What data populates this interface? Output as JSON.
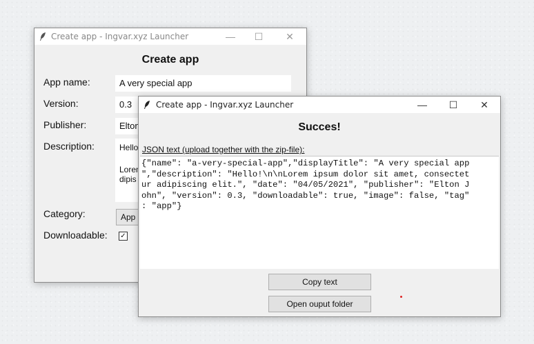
{
  "back_window": {
    "title": "Create app - Ingvar.xyz Launcher",
    "heading": "Create app",
    "labels": {
      "app_name": "App name:",
      "version": "Version:",
      "publisher": "Publisher:",
      "description": "Description:",
      "category": "Category:",
      "downloadable": "Downloadable:"
    },
    "fields": {
      "app_name": "A very special app",
      "version": "0.3",
      "publisher": "Elton",
      "description_line1": "Hello",
      "description_line2": "Lorem",
      "description_line3": "dipis",
      "category": "App",
      "downloadable_checked": "✓"
    },
    "controls": {
      "minimize": "—",
      "maximize": "☐",
      "close": "✕"
    }
  },
  "front_window": {
    "title": "Create app - Ingvar.xyz Launcher",
    "heading": "Succes!",
    "subtitle": "JSON text (upload together with the zip-file):",
    "json_text": "{\"name\": \"a-very-special-app\",\"displayTitle\": \"A very special app\n\",\"description\": \"Hello!\\n\\nLorem ipsum dolor sit amet, consectet\nur adipiscing elit.\", \"date\": \"04/05/2021\", \"publisher\": \"Elton J\nohn\", \"version\": 0.3, \"downloadable\": true, \"image\": false, \"tag\"\n: \"app\"}",
    "buttons": {
      "copy": "Copy text",
      "open": "Open ouput folder"
    },
    "controls": {
      "minimize": "—",
      "maximize": "☐",
      "close": "✕"
    }
  }
}
